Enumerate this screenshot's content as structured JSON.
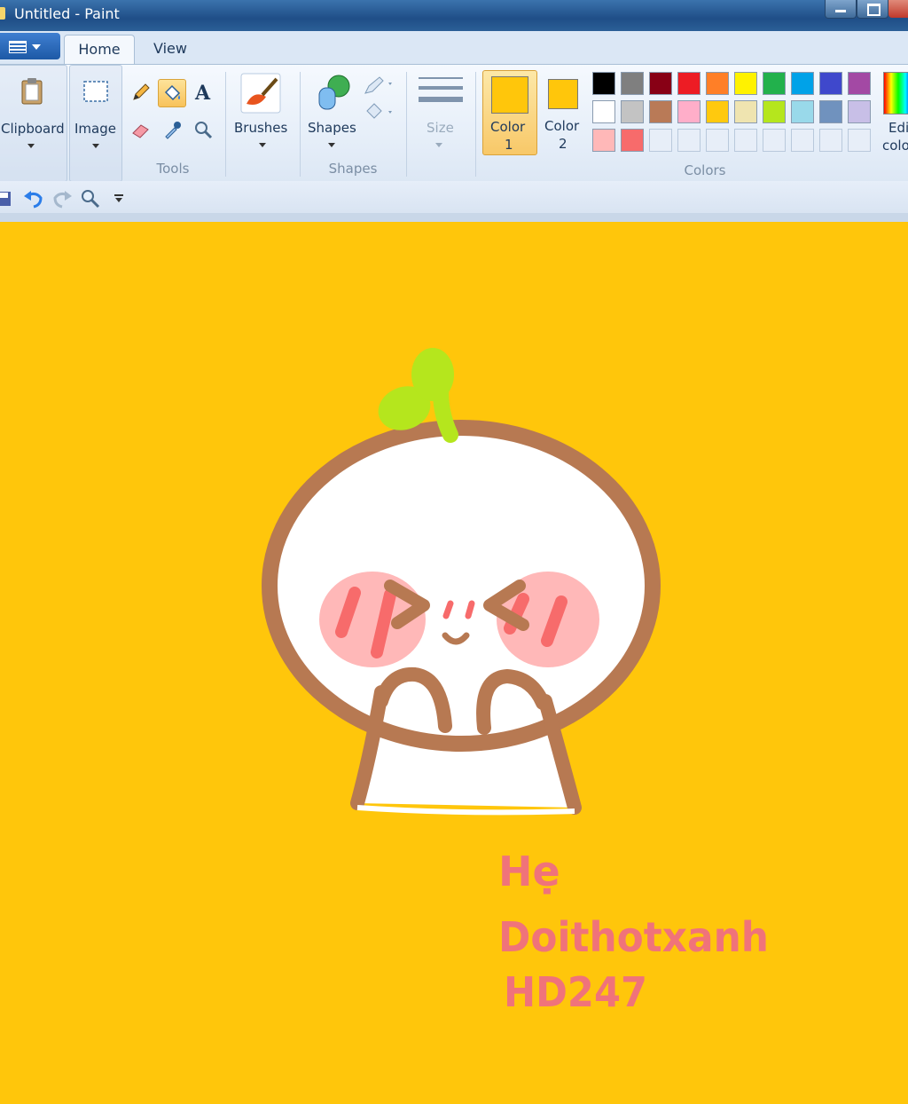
{
  "window": {
    "title": "Untitled - Paint"
  },
  "tabs": [
    {
      "label": "Home"
    },
    {
      "label": "View"
    }
  ],
  "ribbon": {
    "clipboard": {
      "label": "Clipboard"
    },
    "image": {
      "label": "Image"
    },
    "tools": {
      "label": "Tools"
    },
    "brushes": {
      "label": "Brushes"
    },
    "shapes": {
      "button_label": "Shapes",
      "group_label": "Shapes"
    },
    "size": {
      "label": "Size"
    },
    "color1": {
      "label": "Color",
      "number": "1",
      "value": "#FFC60B"
    },
    "color2": {
      "label": "Color",
      "number": "2",
      "value": "#FFC60B"
    },
    "colors": {
      "group_label": "Colors",
      "palette": [
        "#000000",
        "#7F7F7F",
        "#880015",
        "#ED1C24",
        "#FF7F27",
        "#FFF200",
        "#22B14C",
        "#00A2E8",
        "#3F48CC",
        "#A349A4",
        "#FFFFFF",
        "#C3C3C3",
        "#B97A57",
        "#FFAEC9",
        "#FFC90E",
        "#EFE4B0",
        "#B5E61D",
        "#99D9EA",
        "#7092BE",
        "#C8BFE7",
        "#FFB8B8",
        "#F76B6B",
        "",
        "",
        "",
        "",
        "",
        "",
        "",
        ""
      ]
    },
    "edit_colors": {
      "label_line1": "Edi",
      "label_line2": "colo"
    }
  },
  "canvas": {
    "background": "#FFC60B",
    "text_lines": [
      "Hẹ",
      "Doithotxanh",
      "HD247"
    ]
  }
}
